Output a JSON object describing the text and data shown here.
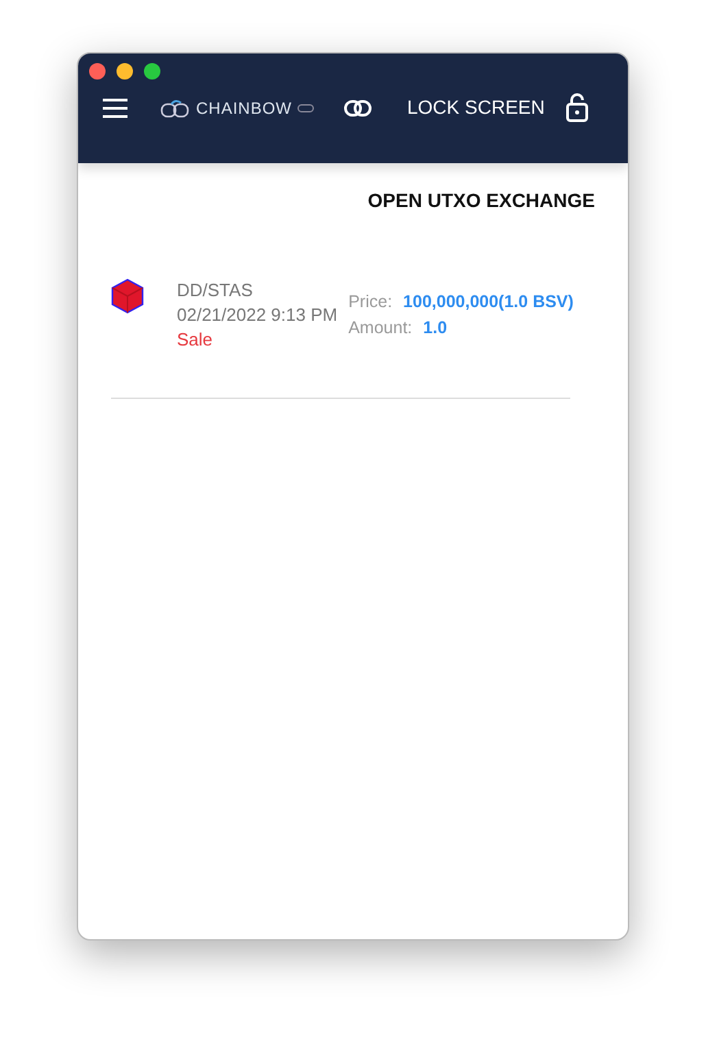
{
  "header": {
    "brand": "CHAINBOW",
    "lock_label": "LOCK SCREEN"
  },
  "page": {
    "action": "OPEN UTXO EXCHANGE"
  },
  "orders": [
    {
      "token": "DD/STAS",
      "date": "02/21/2022 9:13 PM",
      "side": {
        "text": "Sale",
        "kind": "sale"
      },
      "price_label": "Price:",
      "price": "100,000,000(1.0 BSV)",
      "amount_label": "Amount:",
      "amount": "1.0"
    }
  ]
}
